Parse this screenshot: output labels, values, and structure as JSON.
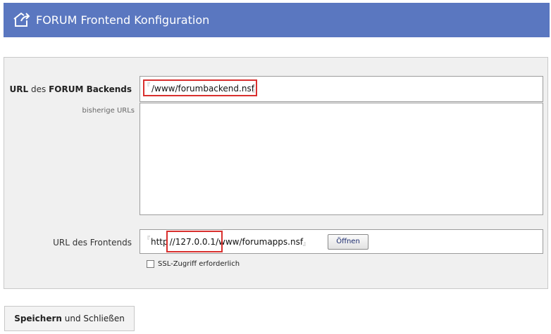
{
  "header": {
    "title": "FORUM Frontend Konfiguration",
    "icon": "home-arrow-icon",
    "background": "#5a77c0"
  },
  "backend": {
    "label_strong_1": "URL",
    "label_mid": " des ",
    "label_strong_2": "FORUM Backends",
    "value": "/www/forumbackend.nsf",
    "history_label": "bisherige URLs",
    "history_values": []
  },
  "frontend": {
    "label": "URL des Frontends",
    "value_prefix": "http",
    "value_highlight": "//127.0.0.1/",
    "value_suffix": "www/forumapps.nsf",
    "open_button": "Öffnen"
  },
  "ssl": {
    "label": "SSL-Zugriff erforderlich",
    "checked": false
  },
  "footer": {
    "save_strong": "Speichern",
    "save_rest": " und Schließen"
  },
  "colors": {
    "highlight": "#d9302e"
  }
}
